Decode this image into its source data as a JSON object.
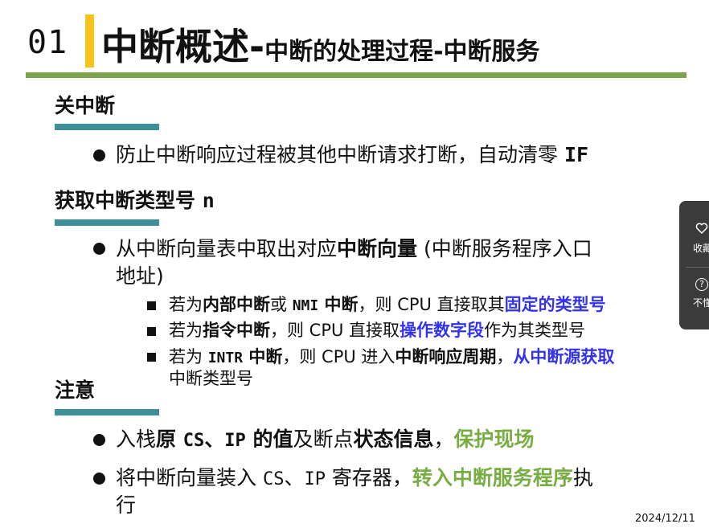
{
  "header": {
    "number": "01",
    "title_main": "中断概述",
    "dash1": "-",
    "title_part1": "中断的处理过程",
    "dash2": "-",
    "title_part2": "中断服务"
  },
  "sections": {
    "s1": {
      "heading": "关中断",
      "bullet1": {
        "text": "防止中断响应过程被其他中断请求打断，自动清零 ",
        "code": "IF"
      }
    },
    "s2": {
      "heading": "获取中断类型号 ",
      "heading_code": "n",
      "bullet1": {
        "a": "从中断向量表中取出对应",
        "b": "中断向量",
        "c": " (中断服务程序入口",
        "d": "地址)"
      },
      "sub1": {
        "a": "若为",
        "b": "内部中断",
        "c": "或 ",
        "d": "NMI",
        "e": " 中断",
        "f": "，则 CPU 直接取其",
        "g": "固定的类型号"
      },
      "sub2": {
        "a": "若为",
        "b": "指令中断",
        "c": "，则 CPU 直接取",
        "d": "操作数字段",
        "e": "作为其类型号"
      },
      "sub3": {
        "a": "若为 ",
        "b": "INTR",
        "c": " 中断",
        "d": "，则 CPU 进入",
        "e": "中断响应周期",
        "f": "，",
        "g": "从中断源获取",
        "h": "中断类型号"
      }
    },
    "s3": {
      "heading": "注意",
      "bullet1": {
        "a": "入栈",
        "b": "原 ",
        "c": "CS",
        "d": "、",
        "e": "IP",
        "f": " 的值",
        "g": "及断点",
        "h": "状态信息",
        "i": "，",
        "j": "保护现场"
      },
      "bullet2": {
        "a": "将中断向量装入 ",
        "b": "CS",
        "c": "、",
        "d": "IP",
        "e": " 寄存器，",
        "f": "转入中断服务程序",
        "g": "执",
        "h": "行"
      }
    }
  },
  "date": "2024/12/11",
  "side_panel": {
    "item1_icon": "heart-icon",
    "item1_label": "收藏",
    "item2_icon": "question-icon",
    "item2_label": "不懂"
  },
  "colors": {
    "accent_yellow": "#f6c31b",
    "rule_green": "#7ba44b",
    "rule_teal": "#3f8f9b",
    "highlight_blue": "#3333ee",
    "highlight_green": "#78ad44"
  }
}
